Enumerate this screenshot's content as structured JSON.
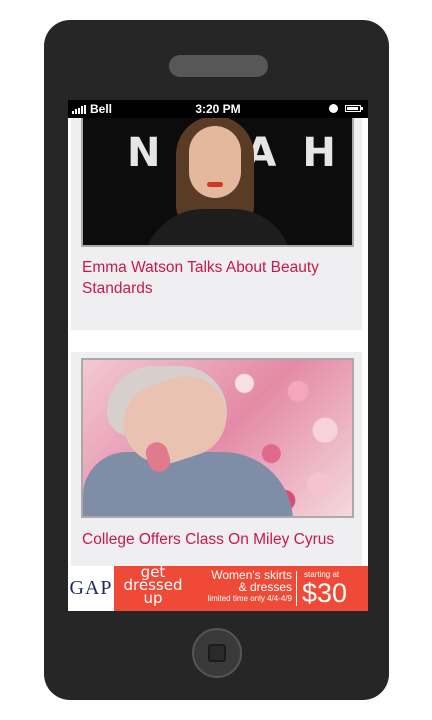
{
  "status_bar": {
    "carrier": "Bell",
    "time": "3:20 PM"
  },
  "feed": {
    "articles": [
      {
        "title": "Emma Watson Talks About Beauty Standards",
        "backdrop_text": "NOAH"
      },
      {
        "title": "College Offers Class On Miley Cyrus"
      }
    ]
  },
  "ad": {
    "brand": "GAP",
    "headline": [
      "get",
      "dressed",
      "up"
    ],
    "offer_line1": "Women's skirts",
    "offer_line2": "& dresses",
    "dates": "limited time only 4/4-4/9",
    "starting": "starting at",
    "price": "$30"
  },
  "colors": {
    "headline": "#c8194a",
    "ad_background": "#ef4a37",
    "phone_body": "#262626"
  }
}
